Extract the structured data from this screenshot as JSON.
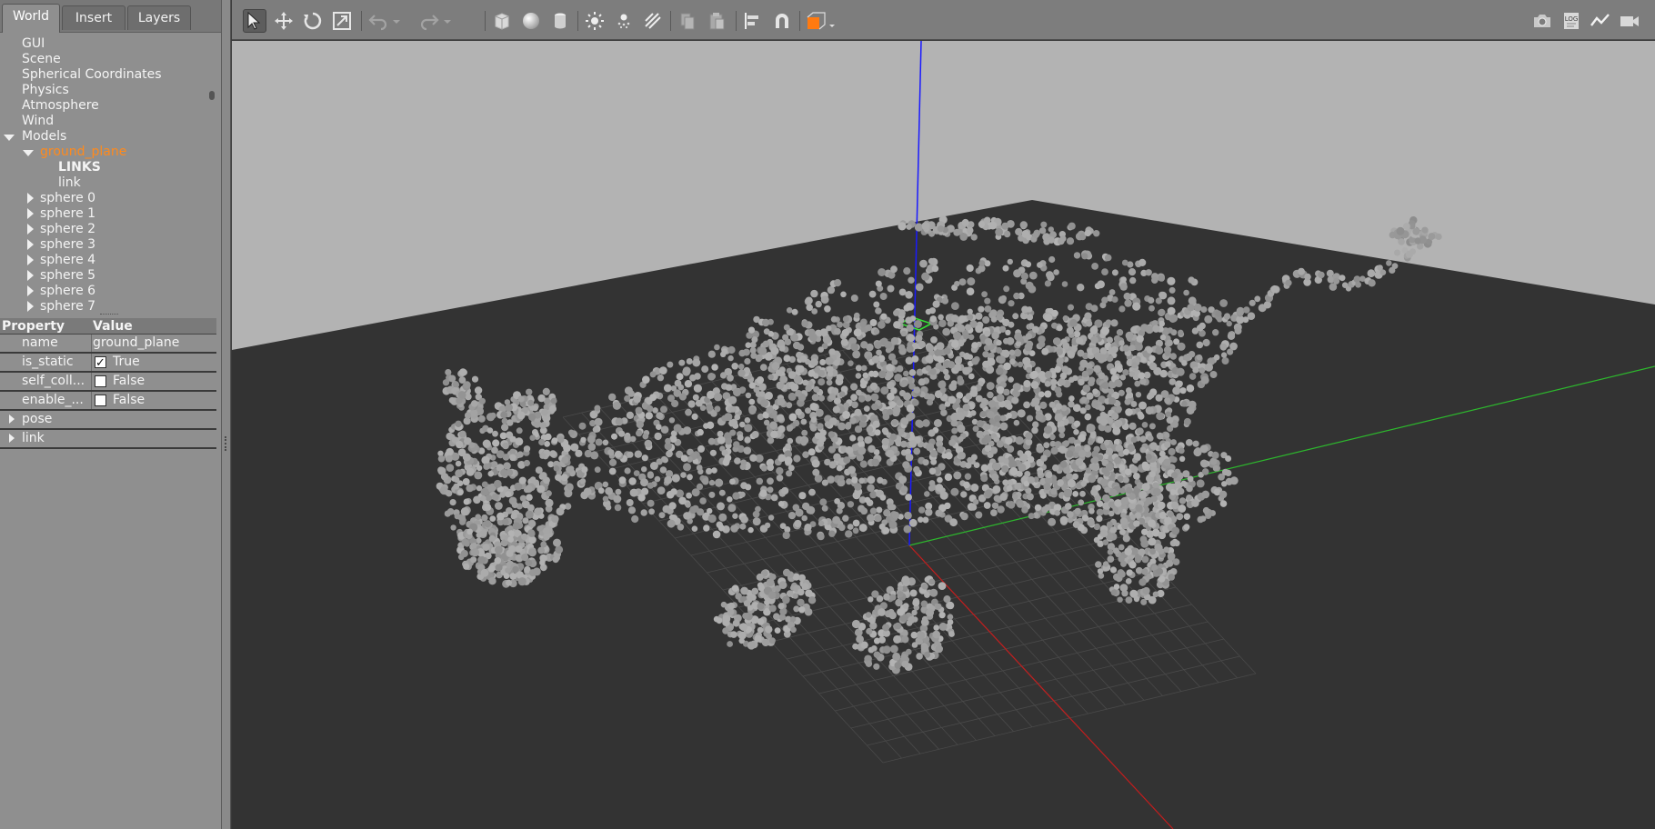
{
  "tabs": [
    {
      "label": "World",
      "active": true
    },
    {
      "label": "Insert",
      "active": false
    },
    {
      "label": "Layers",
      "active": false
    }
  ],
  "tree": {
    "top_items": [
      "GUI",
      "Scene",
      "Spherical Coordinates",
      "Physics",
      "Atmosphere",
      "Wind"
    ],
    "models_label": "Models",
    "selected_model": "ground_plane",
    "links_heading": "LINKS",
    "link_item": "link",
    "spheres": [
      "sphere 0",
      "sphere 1",
      "sphere 2",
      "sphere 3",
      "sphere 4",
      "sphere 5",
      "sphere 6",
      "sphere 7"
    ]
  },
  "properties": {
    "header_property": "Property",
    "header_value": "Value",
    "rows": [
      {
        "key": "name",
        "value": "ground_plane"
      },
      {
        "key": "is_static",
        "value": "True",
        "checked": true
      },
      {
        "key": "self_coll...",
        "value": "False",
        "checked": false
      },
      {
        "key": "enable_...",
        "value": "False",
        "checked": false
      }
    ],
    "groups": [
      "pose",
      "link"
    ]
  },
  "toolbar": {
    "icons": [
      "select-arrow-icon",
      "translate-icon",
      "rotate-icon",
      "scale-icon",
      "undo-icon",
      "undo-dropdown-icon",
      "redo-icon",
      "redo-dropdown-icon",
      "box-icon",
      "sphere-icon",
      "cylinder-icon",
      "point-light-icon",
      "spot-light-icon",
      "directional-light-icon",
      "copy-icon",
      "paste-icon",
      "align-icon",
      "snap-magnet-icon",
      "view-angle-icon",
      "screenshot-icon",
      "log-icon",
      "plot-icon",
      "video-record-icon"
    ],
    "log_text": "LOG"
  },
  "colors": {
    "panel_bg": "#8f8f8f",
    "selected_text": "#ff8a1c",
    "sky": "#b3b3b3",
    "ground": "#333333",
    "axis_z": "#1a1aff",
    "axis_y": "#2db82d",
    "axis_x": "#c41d1d",
    "particle": "#9e9e9e"
  }
}
